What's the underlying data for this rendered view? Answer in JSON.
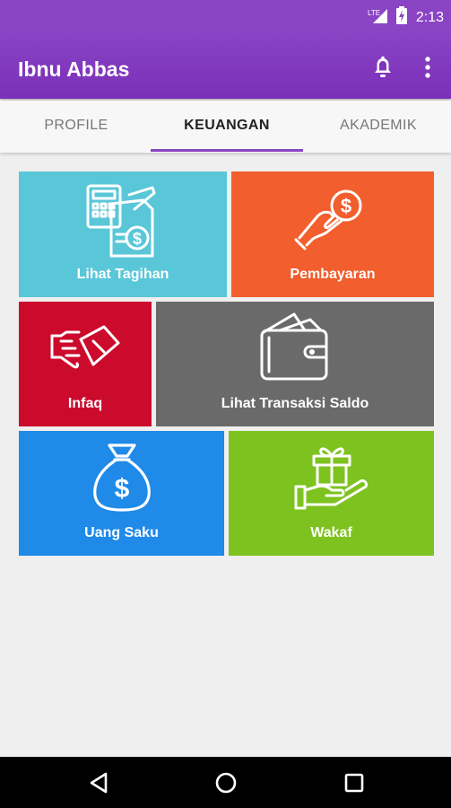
{
  "status_bar": {
    "network": "LTE",
    "time": "2:13"
  },
  "app_bar": {
    "title": "Ibnu Abbas"
  },
  "tabs": [
    {
      "label": "PROFILE"
    },
    {
      "label": "KEUANGAN"
    },
    {
      "label": "AKADEMIK"
    }
  ],
  "menu": [
    {
      "label": "Lihat Tagihan",
      "color": "#59c7d8",
      "icon": "bill-calculator-icon"
    },
    {
      "label": "Pembayaran",
      "color": "#f25e2d",
      "icon": "hand-coin-icon"
    },
    {
      "label": "Infaq",
      "color": "#cb0a2c",
      "icon": "handshake-icon"
    },
    {
      "label": "Lihat Transaksi Saldo",
      "color": "#6a6a6a",
      "icon": "wallet-icon"
    },
    {
      "label": "Uang Saku",
      "color": "#1f8ae8",
      "icon": "money-bag-icon"
    },
    {
      "label": "Wakaf",
      "color": "#7ec21f",
      "icon": "gift-hand-icon"
    }
  ],
  "colors": {
    "primary": "#8a44c4",
    "background": "#efefef"
  }
}
